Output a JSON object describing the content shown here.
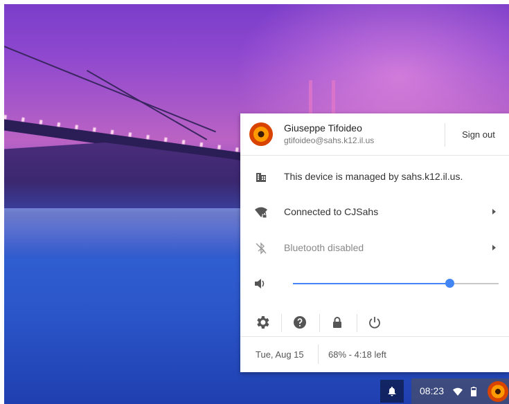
{
  "user": {
    "name": "Giuseppe Tifoideo",
    "email": "gtifoideo@sahs.k12.il.us",
    "sign_out_label": "Sign out"
  },
  "rows": {
    "managed": {
      "label": "This device is managed by sahs.k12.il.us.",
      "icon": "building-icon"
    },
    "network": {
      "label": "Connected to CJSahs",
      "icon": "wifi-locked-icon"
    },
    "bluetooth": {
      "label": "Bluetooth disabled",
      "icon": "bluetooth-disabled-icon"
    }
  },
  "volume": {
    "level": 0.76,
    "icon": "volume-icon"
  },
  "tools": [
    "settings-icon",
    "help-icon",
    "lock-icon",
    "power-icon"
  ],
  "footer": {
    "date": "Tue, Aug 15",
    "battery": "68% - 4:18 left"
  },
  "shelf": {
    "time": "08:23"
  },
  "colors": {
    "accent": "#4285f4",
    "panel_bg": "#ffffff"
  }
}
